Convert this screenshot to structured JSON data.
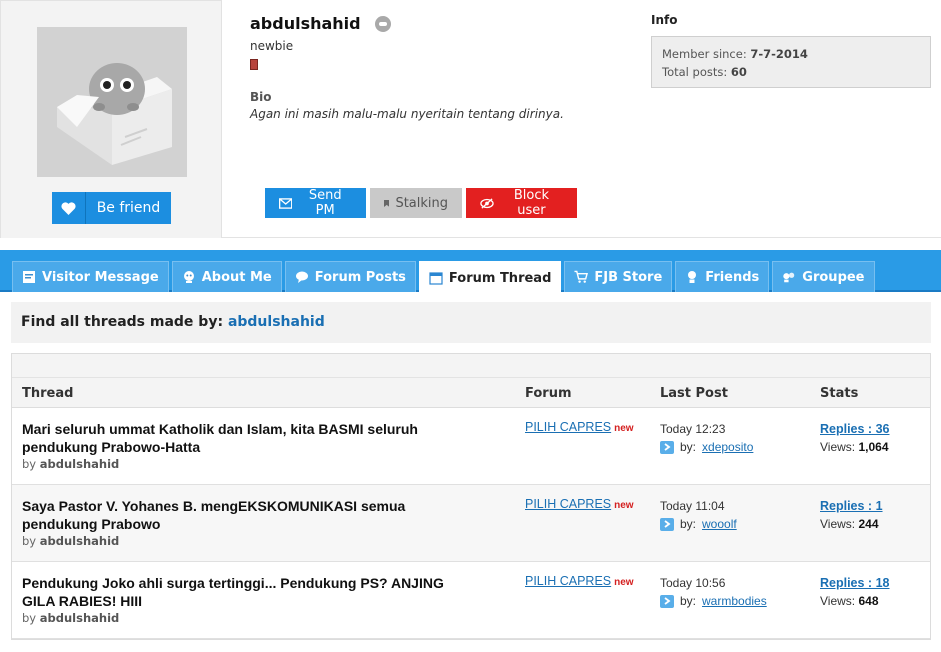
{
  "profile": {
    "username": "abdulshahid",
    "rank": "newbie",
    "bio_heading": "Bio",
    "bio": "Agan ini masih malu-malu nyeritain tentang dirinya.",
    "be_friend": "Be friend",
    "actions": {
      "send_pm": "Send PM",
      "stalking": "Stalking",
      "block": "Block user"
    },
    "info": {
      "heading": "Info",
      "member_since_label": "Member since:",
      "member_since": "7-7-2014",
      "total_posts_label": "Total posts:",
      "total_posts": "60"
    }
  },
  "tabs": [
    {
      "label": "Visitor Message",
      "icon": "message-icon"
    },
    {
      "label": "About Me",
      "icon": "user-icon"
    },
    {
      "label": "Forum Posts",
      "icon": "chat-bubble-icon"
    },
    {
      "label": "Forum Thread",
      "icon": "calendar-icon",
      "active": true
    },
    {
      "label": "FJB Store",
      "icon": "cart-icon"
    },
    {
      "label": "Friends",
      "icon": "friends-icon"
    },
    {
      "label": "Groupee",
      "icon": "group-icon"
    }
  ],
  "find": {
    "label": "Find all threads made by:",
    "user": "abdulshahid"
  },
  "table": {
    "headers": {
      "thread": "Thread",
      "forum": "Forum",
      "last_post": "Last Post",
      "stats": "Stats"
    },
    "by_prefix": "by",
    "new_badge": "new",
    "by_label": "by:",
    "views_label": "Views:",
    "rows": [
      {
        "title": "Mari seluruh ummat Katholik dan Islam, kita BASMI seluruh pendukung Prabowo-Hatta",
        "author": "abdulshahid",
        "forum": "PILIH CAPRES",
        "time": "Today 12:23",
        "last_by": "xdeposito",
        "replies": "Replies : 36",
        "views": "1,064"
      },
      {
        "title": "Saya Pastor V. Yohanes B. mengEKSKOMUNIKASI semua pendukung Prabowo",
        "author": "abdulshahid",
        "forum": "PILIH CAPRES",
        "time": "Today 11:04",
        "last_by": "wooolf",
        "replies": "Replies : 1",
        "views": "244"
      },
      {
        "title": "Pendukung Joko ahli surga tertinggi... Pendukung PS? ANJING GILA RABIES! HIII",
        "author": "abdulshahid",
        "forum": "PILIH CAPRES",
        "time": "Today 10:56",
        "last_by": "warmbodies",
        "replies": "Replies : 18",
        "views": "648"
      }
    ]
  },
  "colors": {
    "accent": "#1c8ee0",
    "tabbar": "#2a9be6",
    "danger": "#e32020",
    "link": "#1a6fb3"
  }
}
